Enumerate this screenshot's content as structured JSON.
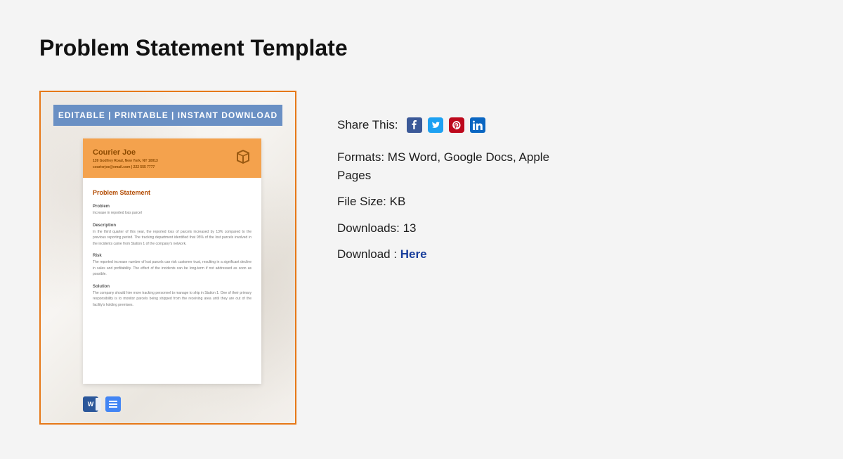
{
  "title": "Problem Statement Template",
  "preview": {
    "banner": "EDITABLE  |  PRINTABLE  |  INSTANT DOWNLOAD",
    "brand": "Courier Joe",
    "address": "139 Godfrey Road, New York, NY 10013",
    "contact": "courierjoe@email.com | 222 555 7777",
    "ps_title": "Problem Statement",
    "sections": {
      "problem": {
        "h": "Problem",
        "t": "Increase in reported loss parcel"
      },
      "description": {
        "h": "Description",
        "t": "In the third quarter of this year, the reported loss of parcels increased by 13% compared to the previous reporting period. The tracking department identified that 95% of the lost parcels involved in the incidents came from Station 1 of the company's network."
      },
      "risk": {
        "h": "Risk",
        "t": "The reported increase number of lost parcels can risk customer trust, resulting in a significant decline in sales and profitability. The effect of the incidents can be long-term if not addressed as soon as possible."
      },
      "solution": {
        "h": "Solution",
        "t": "The company should hire more tracking personnel to manage to ship in Station 1. One of their primary responsibility is to monitor parcels being shipped from the receiving area until they are out of the facility's holding premises."
      }
    },
    "word_letter": "W"
  },
  "info": {
    "share_label": "Share This:",
    "formats_label": "Formats: ",
    "formats_value": "MS Word, Google Docs, Apple Pages",
    "filesize_label": "File Size: ",
    "filesize_value": "KB",
    "downloads_label": "Downloads: ",
    "downloads_value": "13",
    "download_label": "Download : ",
    "download_link": "Here"
  }
}
